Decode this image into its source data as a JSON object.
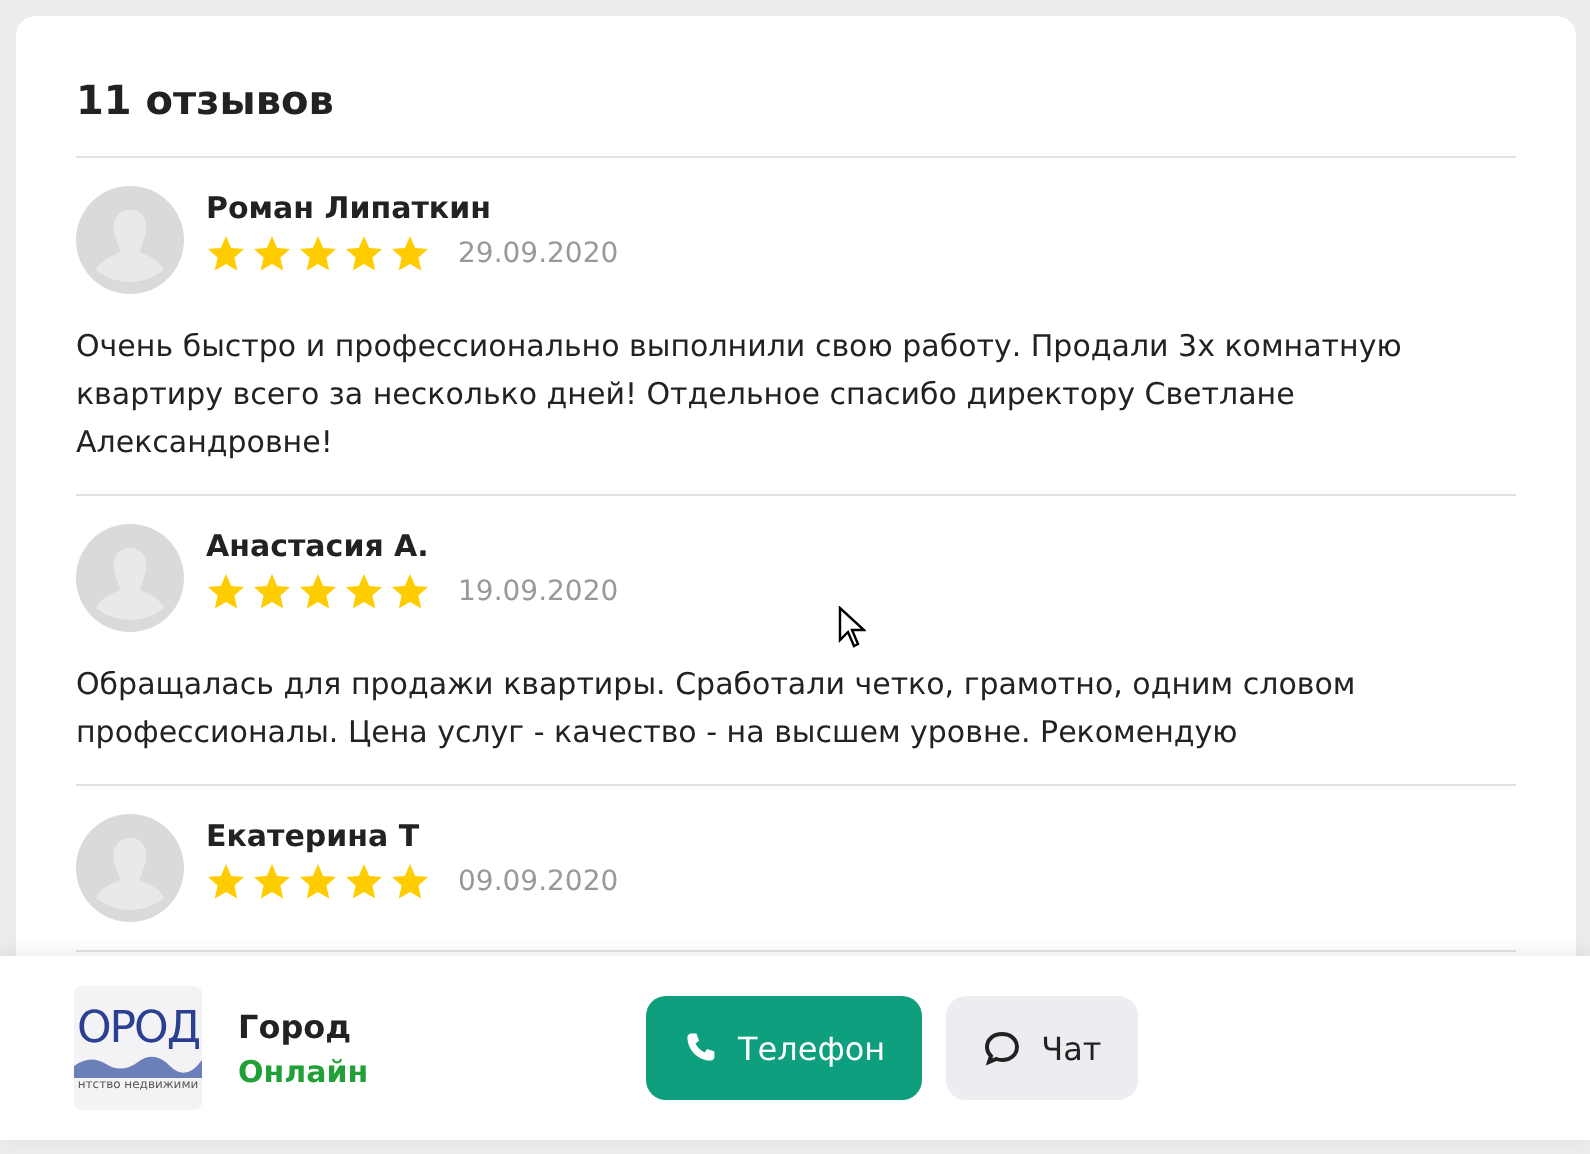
{
  "reviews_panel": {
    "title": "11 отзывов",
    "reviews": [
      {
        "author": "Роман Липаткин",
        "stars": 5,
        "date": "29.09.2020",
        "text": "Очень быстро и профессионально выполнили свою работу. Продали 3х комнатную квартиру всего за несколько дней! Отдельное спасибо директору Светлане Александровне!"
      },
      {
        "author": "Анастасия А.",
        "stars": 5,
        "date": "19.09.2020",
        "text": "Обращалась для продажи квартиры. Сработали четко, грамотно, одним словом профессионалы. Цена услуг - качество - на высшем уровне. Рекомендую"
      },
      {
        "author": "Екатерина Т",
        "stars": 5,
        "date": "09.09.2020"
      }
    ]
  },
  "contact_bar": {
    "logo": {
      "text": "ОРОД",
      "tagline": "нтство недвижими"
    },
    "name": "Город",
    "status": "Онлайн",
    "online": true,
    "buttons": [
      {
        "kind": "phone",
        "label": "Телефон"
      },
      {
        "kind": "chat",
        "label": "Чат"
      }
    ]
  }
}
